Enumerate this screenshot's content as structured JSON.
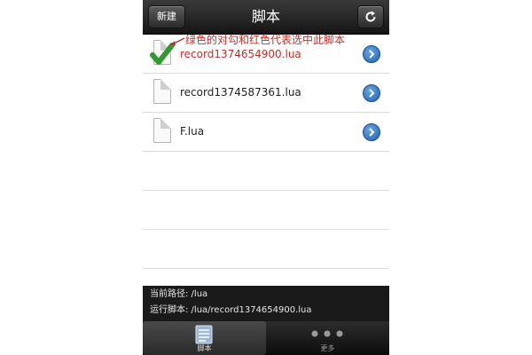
{
  "navbar": {
    "new_label": "新建",
    "title": "脚本",
    "refresh_icon": "refresh-icon"
  },
  "annotation": "绿色的对勾和红色代表选中此脚本",
  "files": [
    {
      "name": "record1374654900.lua",
      "selected": true
    },
    {
      "name": "record1374587361.lua",
      "selected": false
    },
    {
      "name": "F.lua",
      "selected": false
    }
  ],
  "status": {
    "current_path": "当前路径: /lua",
    "running_script": "运行脚本: /lua/record1374654900.lua"
  },
  "tabs": [
    {
      "label": "脚本",
      "icon": "script-list-icon",
      "active": true
    },
    {
      "label": "更多",
      "icon": "more-dots-icon",
      "active": false
    }
  ],
  "colors": {
    "selected_text": "#c0302a",
    "check_green": "#2f9a2f",
    "disclosure_blue": "#1d5fb2"
  }
}
